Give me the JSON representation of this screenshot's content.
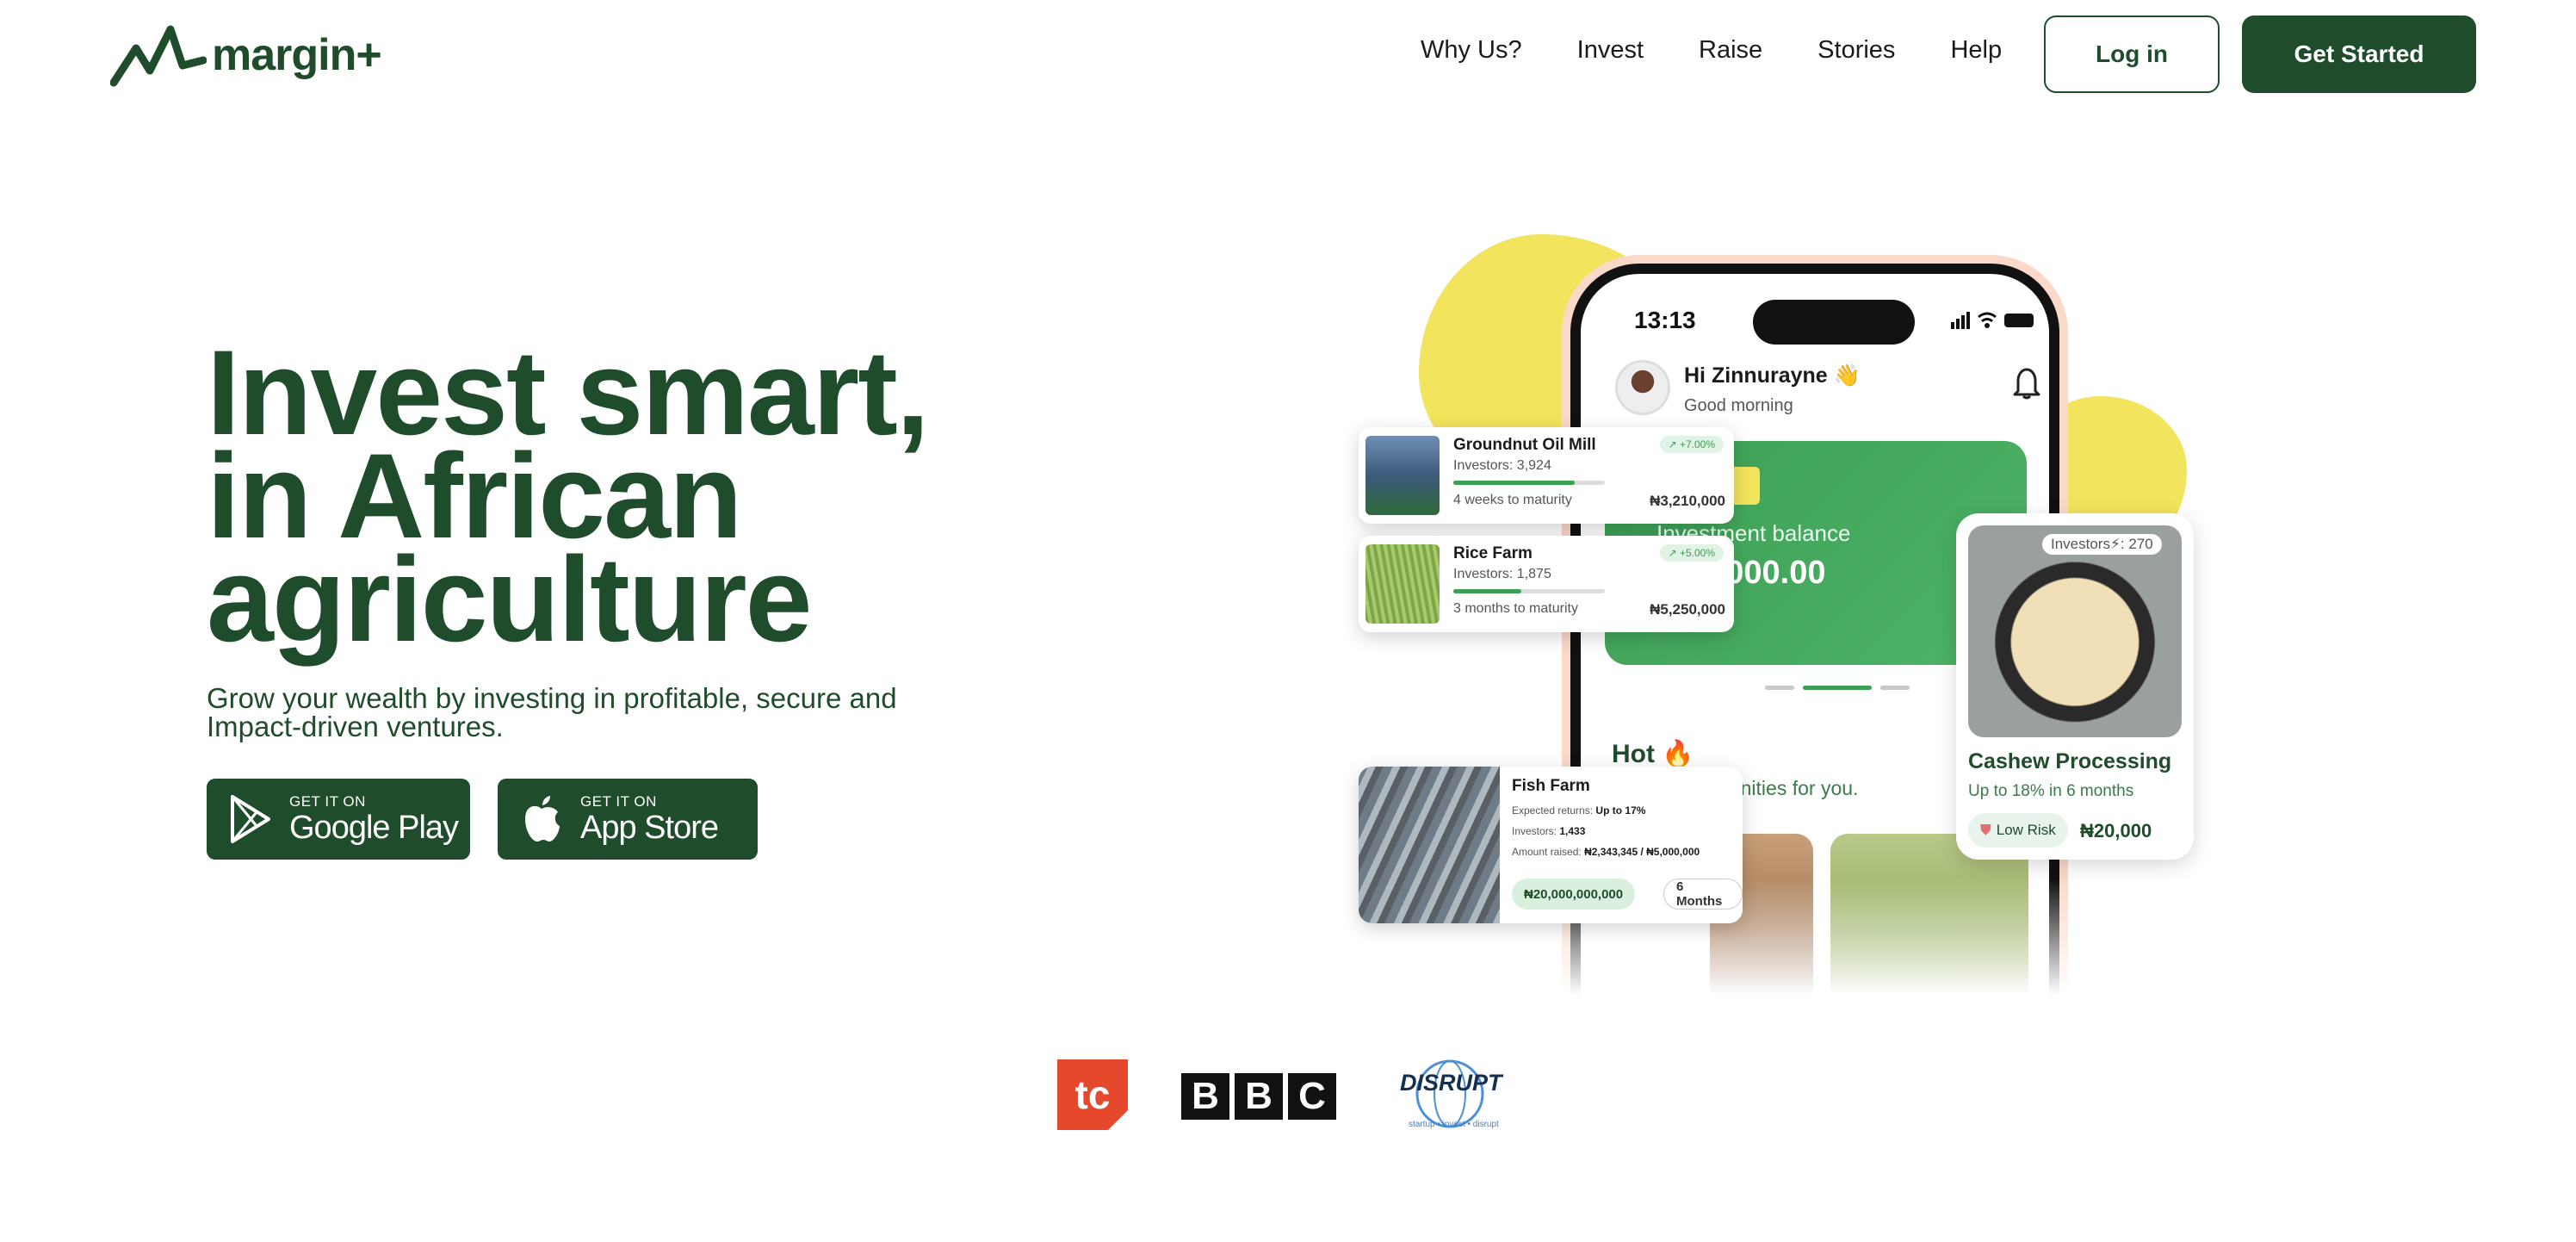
{
  "brand": {
    "name": "margin+",
    "color": "#1f4d2c",
    "accent": "#3c9f54",
    "highlight": "#f2e45c"
  },
  "nav": {
    "links": [
      "Why Us?",
      "Invest",
      "Raise",
      "Stories",
      "Help"
    ],
    "login_label": "Log in",
    "get_started_label": "Get Started"
  },
  "hero": {
    "title_line1": "Invest smart,",
    "title_line2": "in African",
    "title_line3": "agriculture",
    "subtitle_line1": "Grow your wealth by investing in profitable, secure and",
    "subtitle_line2": "Impact-driven ventures.",
    "google_play": {
      "small": "GET IT ON",
      "big": "Google Play",
      "icon": "google-play-icon"
    },
    "app_store": {
      "small": "GET IT ON",
      "big": "App Store",
      "icon": "apple-icon"
    }
  },
  "phone": {
    "time": "13:13",
    "greeting": "Hi Zinnurayne 👋",
    "greeting_sub": "Good morning",
    "balance_label": "Investment balance",
    "balance_value": "₦60,000.00",
    "hot_title": "Hot 🔥",
    "hot_sub": "Vetted opportunities for you."
  },
  "cards": [
    {
      "name": "Groundnut Oil Mill",
      "investors": "Investors:  3,924",
      "maturity": "4 weeks to maturity",
      "amount": "₦3,210,000",
      "badge": "↗ +7.00%",
      "progress": 0.8
    },
    {
      "name": "Rice Farm",
      "investors": "Investors:  1,875",
      "maturity": "3 months to maturity",
      "amount": "₦5,250,000",
      "badge": "↗ +5.00%",
      "progress": 0.45
    }
  ],
  "fish_farm": {
    "name": "Fish Farm",
    "returns_label": "Expected returns:",
    "returns_value": "Up to 17%",
    "investors_label": "Investors:",
    "investors_value": "1,433",
    "raised_label": "Amount raised:",
    "raised_value": "₦2,343,345 / ₦5,000,000",
    "pill_amount": "₦20,000,000,000",
    "pill_duration": "6 Months"
  },
  "cashew": {
    "badge": "Investors⚡: 270",
    "name": "Cashew Processing",
    "returns": "Up to 18% in 6 months",
    "risk": "Low Risk",
    "amount": "₦20,000"
  },
  "press": {
    "techcabal": "tc",
    "bbc": [
      "B",
      "B",
      "C"
    ],
    "disrupt": "DISRUPT",
    "disrupt_tag": "startup • invest • disrupt"
  }
}
